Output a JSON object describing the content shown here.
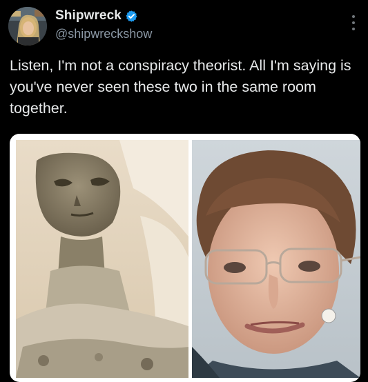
{
  "author": {
    "display_name": "Shipwreck",
    "handle": "@shipwreckshow",
    "verified": true
  },
  "tweet": {
    "text": "Listen, I'm not a conspiracy theorist. All I'm saying is you've never seen these two in the same room together."
  },
  "icons": {
    "verified": "verified-badge-icon",
    "more": "more-options-icon"
  },
  "colors": {
    "background": "#000000",
    "text_primary": "#e7e9ea",
    "text_secondary": "#8b98a5",
    "verified_blue": "#1d9bf0"
  }
}
